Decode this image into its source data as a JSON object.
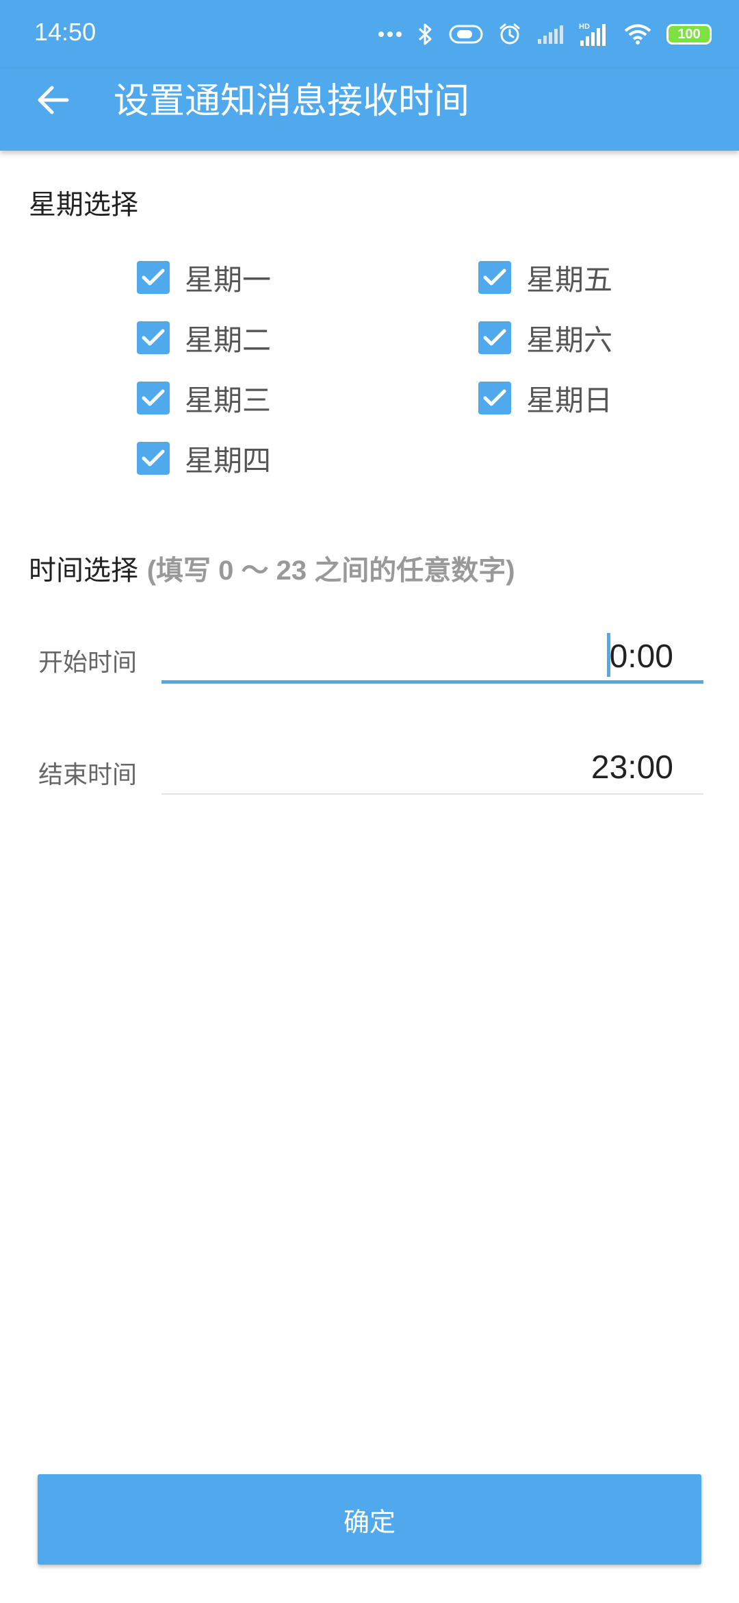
{
  "status_bar": {
    "time": "14:50",
    "battery_level": "100",
    "icons": [
      "more-dots-icon",
      "bluetooth-icon",
      "toggle-icon",
      "alarm-icon",
      "signal-icon",
      "signal-hd-icon",
      "wifi-icon",
      "battery-icon"
    ],
    "hd_label": "HD"
  },
  "app_bar": {
    "title": "设置通知消息接收时间",
    "back_icon": "arrow-left-icon",
    "background_color": "#4fa9ec"
  },
  "weekday_section": {
    "title": "星期选择",
    "days": [
      {
        "label": "星期一",
        "checked": true
      },
      {
        "label": "星期二",
        "checked": true
      },
      {
        "label": "星期三",
        "checked": true
      },
      {
        "label": "星期四",
        "checked": true
      },
      {
        "label": "星期五",
        "checked": true
      },
      {
        "label": "星期六",
        "checked": true
      },
      {
        "label": "星期日",
        "checked": true
      }
    ]
  },
  "time_section": {
    "title": "时间选择",
    "hint": "(填写 0 ～ 23 之间的任意数字)",
    "start": {
      "label": "开始时间",
      "value": "0:00"
    },
    "end": {
      "label": "结束时间",
      "value": "23:00"
    }
  },
  "confirm_button": {
    "label": "确定"
  },
  "colors": {
    "accent": "#4fa9ec",
    "battery": "#7ee041"
  }
}
